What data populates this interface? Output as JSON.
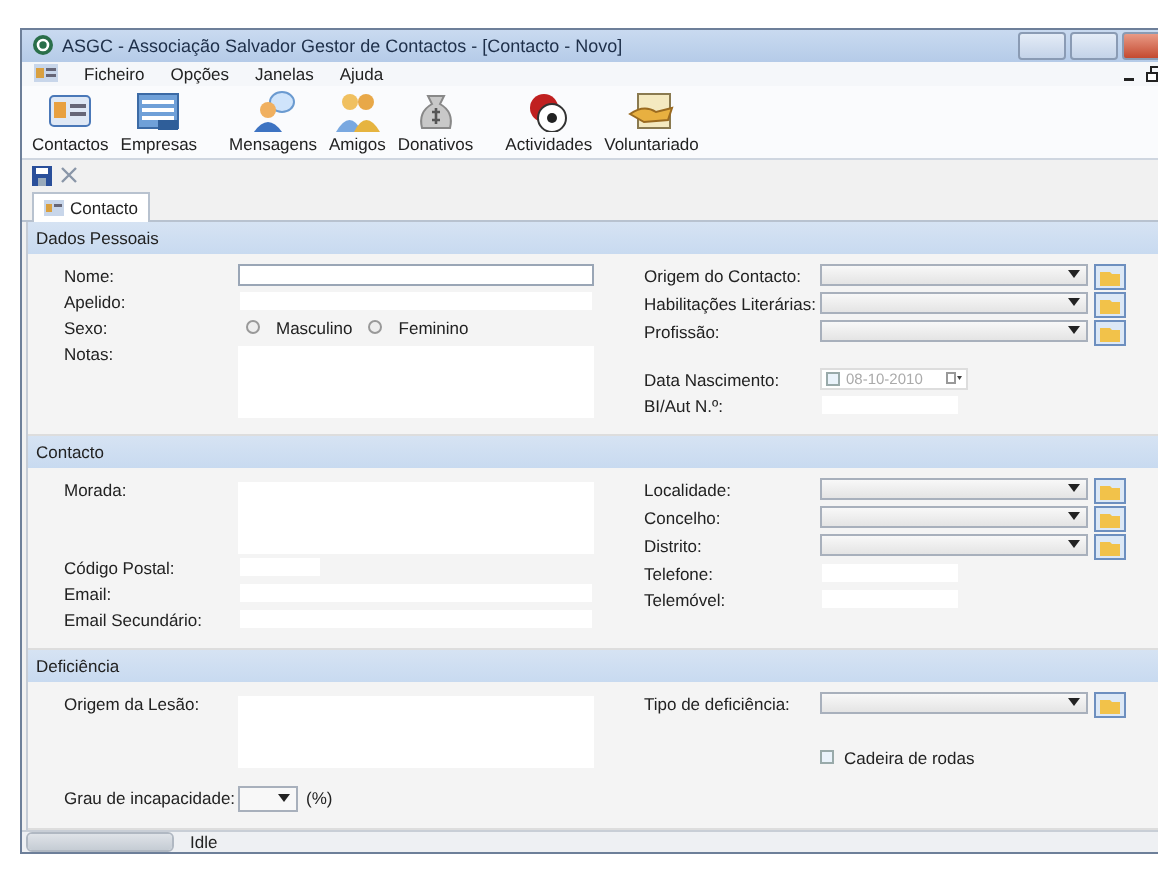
{
  "window": {
    "title": "ASGC - Associação Salvador Gestor de Contactos - [Contacto - Novo]"
  },
  "menu": [
    "Ficheiro",
    "Opções",
    "Janelas",
    "Ajuda"
  ],
  "toolbar": [
    {
      "label": "Contactos",
      "kind": "card"
    },
    {
      "label": "Empresas",
      "kind": "building"
    },
    {
      "label": "Mensagens",
      "kind": "chat"
    },
    {
      "label": "Amigos",
      "kind": "people"
    },
    {
      "label": "Donativos",
      "kind": "money"
    },
    {
      "label": "Actividades",
      "kind": "ball"
    },
    {
      "label": "Voluntariado",
      "kind": "hands"
    }
  ],
  "tabs": [
    {
      "label": "Contacto",
      "selected": true
    }
  ],
  "sections": [
    {
      "title": "Dados Pessoais",
      "left": [
        {
          "label": "Nome:",
          "kind": "text",
          "focused": true
        },
        {
          "label": "Apelido:",
          "kind": "text",
          "focused": false
        },
        {
          "label": "Sexo:",
          "kind": "radio",
          "options": [
            {
              "label": "Masculino",
              "selected": false
            },
            {
              "label": "Feminino",
              "selected": false
            }
          ]
        },
        {
          "label": "Notas:",
          "kind": "textarea"
        }
      ],
      "right": [
        {
          "label": "Origem do Contacto:",
          "kind": "combo"
        },
        {
          "label": "Habilitações Literárias:",
          "kind": "combo"
        },
        {
          "label": "Profissão:",
          "kind": "combo"
        },
        {
          "label": "Data Nascimento:",
          "kind": "date",
          "value": "08-10-2010",
          "checked": false
        },
        {
          "label": "BI/Aut N.º:",
          "kind": "text",
          "focused": false
        }
      ]
    },
    {
      "title": "Contacto",
      "left": [
        {
          "label": "Morada:",
          "kind": "textarea"
        },
        {
          "label": "Código Postal:",
          "kind": "short"
        },
        {
          "label": "Email:",
          "kind": "text",
          "focused": false
        },
        {
          "label": "Email Secundário:",
          "kind": "text",
          "focused": false
        }
      ],
      "right": [
        {
          "label": "Localidade:",
          "kind": "combo"
        },
        {
          "label": "Concelho:",
          "kind": "combo"
        },
        {
          "label": "Distrito:",
          "kind": "combo"
        },
        {
          "label": "Telefone:",
          "kind": "short"
        },
        {
          "label": "Telemóvel:",
          "kind": "short"
        }
      ]
    },
    {
      "title": "Deficiência",
      "left": [
        {
          "label": "Origem da Lesão:",
          "kind": "textarea"
        },
        {
          "label": "Grau de incapacidade:",
          "kind": "smallcombo",
          "suffix": "(%)"
        }
      ],
      "right": [
        {
          "label": "Tipo de deficiência:",
          "kind": "combo"
        },
        {
          "label": "Cadeira de rodas",
          "kind": "checkbox",
          "checked": false
        }
      ]
    }
  ],
  "status_bar": {
    "text": "Idle",
    "level": 1
  }
}
